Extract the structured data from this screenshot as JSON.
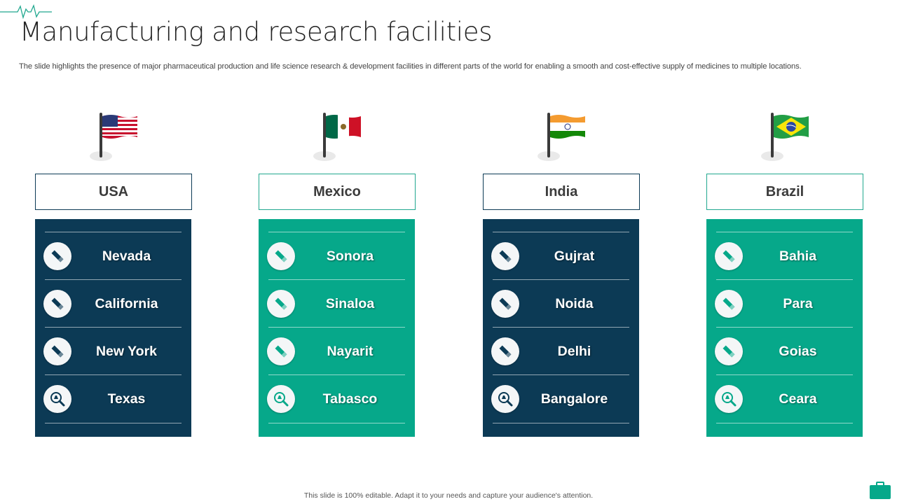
{
  "slide": {
    "title": "Manufacturing and research facilities",
    "subtitle": "The slide highlights the presence of major pharmaceutical production and life science research & development facilities in different parts of the world for  enabling a smooth and cost-effective supply of medicines to multiple locations.",
    "footer": "This slide is 100% editable. Adapt it to your needs and capture your audience's attention."
  },
  "colors": {
    "navy": "#0c3a55",
    "green": "#06a88a",
    "accent_line": "#21a88f"
  },
  "columns": [
    {
      "country": "USA",
      "flag": "usa-flag",
      "theme": "navy",
      "locations": [
        {
          "name": "Nevada",
          "icon": "cigarette-icon"
        },
        {
          "name": "California",
          "icon": "cigarette-icon"
        },
        {
          "name": "New York",
          "icon": "cigarette-icon"
        },
        {
          "name": "Texas",
          "icon": "lab-search-icon"
        }
      ]
    },
    {
      "country": "Mexico",
      "flag": "mexico-flag",
      "theme": "green",
      "locations": [
        {
          "name": "Sonora",
          "icon": "cigarette-icon"
        },
        {
          "name": "Sinaloa",
          "icon": "cigarette-icon"
        },
        {
          "name": "Nayarit",
          "icon": "cigarette-icon"
        },
        {
          "name": "Tabasco",
          "icon": "lab-search-icon"
        }
      ]
    },
    {
      "country": "India",
      "flag": "india-flag",
      "theme": "navy",
      "locations": [
        {
          "name": "Gujrat",
          "icon": "cigarette-icon"
        },
        {
          "name": "Noida",
          "icon": "cigarette-icon"
        },
        {
          "name": "Delhi",
          "icon": "cigarette-icon"
        },
        {
          "name": "Bangalore",
          "icon": "lab-search-icon"
        }
      ]
    },
    {
      "country": "Brazil",
      "flag": "brazil-flag",
      "theme": "green",
      "locations": [
        {
          "name": "Bahia",
          "icon": "cigarette-icon"
        },
        {
          "name": "Para",
          "icon": "cigarette-icon"
        },
        {
          "name": "Goias",
          "icon": "cigarette-icon"
        },
        {
          "name": "Ceara",
          "icon": "lab-search-icon"
        }
      ]
    }
  ]
}
